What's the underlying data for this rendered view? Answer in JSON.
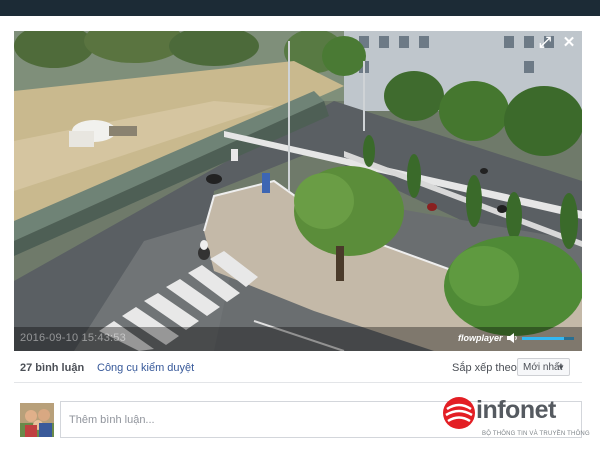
{
  "video": {
    "timestamp": "2016-09-10 15:43:53",
    "player_brand": "flowplayer",
    "volume_level": 0.8,
    "icons": {
      "expand": "expand-icon",
      "close": "close-icon",
      "volume": "volume-icon"
    }
  },
  "comments": {
    "count_label": "27 bình luận",
    "moderation_link": "Công cụ kiểm duyệt",
    "sort_label": "Sắp xếp theo",
    "sort_value": "Mới nhất",
    "input_placeholder": "Thêm bình luận..."
  },
  "watermark": {
    "brand": "infonet",
    "subtitle": "BỘ THÔNG TIN VÀ TRUYỀN THÔNG"
  },
  "colors": {
    "topbar": "#1c2b36",
    "link": "#365899",
    "logo_red": "#e31e24",
    "logo_gray": "#555a60",
    "volume_fill": "#33b7f2"
  }
}
